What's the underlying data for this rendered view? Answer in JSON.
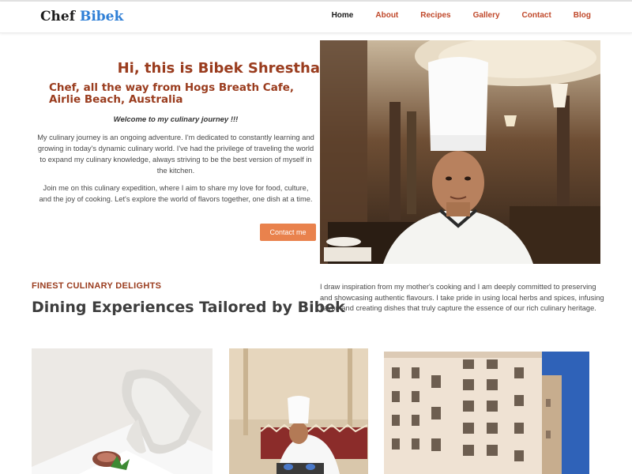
{
  "brand": {
    "name": "Chef",
    "accent": "Bibek",
    "accent_color": "#2f7fd6"
  },
  "nav": {
    "items": [
      "Home",
      "About",
      "Recipes",
      "Gallery",
      "Contact",
      "Blog"
    ],
    "active": "Home",
    "link_color": "#c0492b"
  },
  "hero": {
    "title": "Hi, this is Bibek Shrestha",
    "subtitle": "Chef, all the way from Hogs Breath Cafe, Airlie Beach, Australia",
    "welcome": "Welcome to my culinary journey !!!",
    "paragraph1": "My culinary journey is an ongoing adventure. I'm dedicated to constantly learning and growing in today's dynamic culinary world. I've had the privilege of traveling the world to expand my culinary knowledge, always striving to be the best version of myself in the kitchen.",
    "paragraph2": "Join me on this culinary expedition, where I aim to share my love for food, culture, and the joy of cooking. Let's explore the world of flavors together, one dish at a time.",
    "button": "Contact me",
    "button_color": "#e9824d",
    "accent_color": "#9a3c1e"
  },
  "section": {
    "eyebrow": "FINEST CULINARY DELIGHTS",
    "title": "Dining Experiences Tailored by Bibek",
    "text": "I draw inspiration from my mother's cooking and I am deeply committed to preserving and showcasing authentic flavours. I take pride in using local herbs and spices, infusing flavor, and creating dishes that truly capture the essence of our rich culinary heritage."
  }
}
